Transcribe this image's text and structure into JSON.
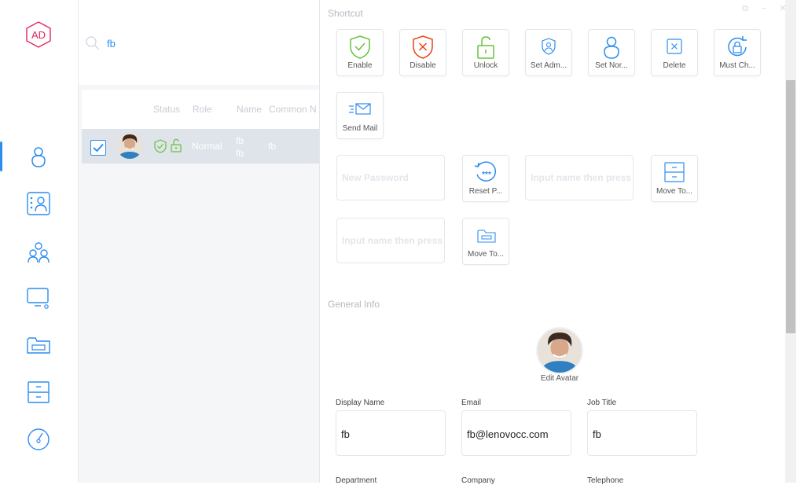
{
  "logo": {
    "text": "AD"
  },
  "search": {
    "value": "fb"
  },
  "table": {
    "headers": {
      "status": "Status",
      "role": "Role",
      "name": "Name",
      "common_name": "Common N"
    },
    "rows": [
      {
        "role": "Normal",
        "name1": "fb",
        "name2": "fb",
        "common_name": "fb"
      }
    ]
  },
  "panel": {
    "shortcut_title": "Shortcut",
    "tiles": {
      "enable": "Enable",
      "disable": "Disable",
      "unlock": "Unlock",
      "set_admin": "Set Adm...",
      "set_normal": "Set Nor...",
      "delete": "Delete",
      "must_change": "Must Ch...",
      "send_mail": "Send Mail",
      "reset_password": "Reset P...",
      "move_to_1": "Move To...",
      "move_to_2": "Move To..."
    },
    "inputs": {
      "new_password_placeholder": "New Password",
      "move_target_1_placeholder": "Input name then press",
      "move_target_2_placeholder": "Input name then press"
    },
    "general_title": "General Info",
    "edit_avatar": "Edit Avatar",
    "fields": {
      "display_name_label": "Display Name",
      "display_name_value": "fb",
      "email_label": "Email",
      "email_value": "fb@lenovocc.com",
      "job_title_label": "Job Title",
      "job_title_value": "fb",
      "department_label": "Department",
      "company_label": "Company",
      "telephone_label": "Telephone"
    }
  },
  "colors": {
    "accent": "#2d8cf0",
    "success": "#67c23a",
    "danger": "#ed4014",
    "logo": "#e2245e"
  }
}
